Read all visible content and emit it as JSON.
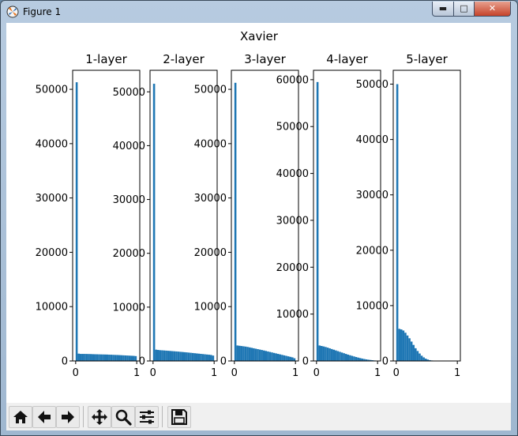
{
  "window": {
    "title": "Figure 1",
    "buttons": {
      "minimize": "▬",
      "maximize": "□",
      "close": "✕"
    }
  },
  "figure": {
    "suptitle": "Xavier"
  },
  "chart_data": [
    {
      "type": "bar",
      "title": "1-layer",
      "xlim": [
        0,
        1
      ],
      "ylim": [
        0,
        53500
      ],
      "xticks": [
        "0",
        "1"
      ],
      "yticks": [
        0,
        10000,
        20000,
        30000,
        40000,
        50000
      ],
      "bins": 30,
      "values": [
        51300,
        1350,
        1300,
        1300,
        1300,
        1290,
        1280,
        1270,
        1250,
        1240,
        1230,
        1220,
        1210,
        1200,
        1190,
        1180,
        1160,
        1150,
        1130,
        1110,
        1100,
        1080,
        1060,
        1040,
        1020,
        1000,
        980,
        960,
        940,
        900
      ],
      "color": "#1f77b4"
    },
    {
      "type": "bar",
      "title": "2-layer",
      "xlim": [
        0,
        1
      ],
      "ylim": [
        0,
        54000
      ],
      "xticks": [
        "0",
        "1"
      ],
      "yticks": [
        0,
        10000,
        20000,
        30000,
        40000,
        50000
      ],
      "bins": 30,
      "values": [
        51500,
        2100,
        2050,
        2000,
        1980,
        1950,
        1920,
        1890,
        1860,
        1830,
        1800,
        1770,
        1740,
        1700,
        1670,
        1630,
        1600,
        1560,
        1520,
        1480,
        1440,
        1400,
        1360,
        1320,
        1280,
        1240,
        1200,
        1160,
        1120,
        1000
      ],
      "color": "#1f77b4"
    },
    {
      "type": "bar",
      "title": "3-layer",
      "xlim": [
        0,
        1
      ],
      "ylim": [
        0,
        53500
      ],
      "xticks": [
        "0",
        "1"
      ],
      "yticks": [
        0,
        10000,
        20000,
        30000,
        40000,
        50000
      ],
      "bins": 30,
      "values": [
        51200,
        2850,
        2800,
        2750,
        2700,
        2650,
        2580,
        2500,
        2420,
        2340,
        2260,
        2180,
        2100,
        2020,
        1930,
        1840,
        1750,
        1660,
        1570,
        1480,
        1390,
        1300,
        1210,
        1120,
        1030,
        940,
        850,
        760,
        670,
        500
      ],
      "color": "#1f77b4"
    },
    {
      "type": "bar",
      "title": "4-layer",
      "xlim": [
        0,
        1
      ],
      "ylim": [
        0,
        62000
      ],
      "xticks": [
        "0",
        "1"
      ],
      "yticks": [
        0,
        10000,
        20000,
        30000,
        40000,
        50000,
        60000
      ],
      "bins": 30,
      "values": [
        59500,
        3300,
        3200,
        3100,
        2980,
        2850,
        2700,
        2550,
        2400,
        2250,
        2100,
        1950,
        1800,
        1650,
        1500,
        1350,
        1220,
        1090,
        960,
        840,
        720,
        610,
        510,
        420,
        340,
        270,
        210,
        160,
        110,
        60
      ],
      "color": "#1f77b4"
    },
    {
      "type": "bar",
      "title": "5-layer",
      "xlim": [
        0,
        1
      ],
      "ylim": [
        0,
        52500
      ],
      "xticks": [
        "0",
        "1"
      ],
      "yticks": [
        0,
        10000,
        20000,
        30000,
        40000,
        50000
      ],
      "bins": 30,
      "values": [
        50000,
        5800,
        5700,
        5500,
        5100,
        4600,
        4100,
        3500,
        2900,
        2300,
        1800,
        1350,
        950,
        650,
        420,
        260,
        150,
        90,
        50,
        30,
        15,
        8,
        4,
        2,
        1,
        0,
        0,
        0,
        0,
        0
      ],
      "color": "#1f77b4"
    }
  ],
  "toolbar": {
    "items": [
      {
        "name": "home-button",
        "icon": "home-icon",
        "tip": "Home"
      },
      {
        "name": "back-button",
        "icon": "arrow-left-icon",
        "tip": "Back"
      },
      {
        "name": "forward-button",
        "icon": "arrow-right-icon",
        "tip": "Forward"
      },
      {
        "name": "pan-button",
        "icon": "move-icon",
        "tip": "Pan"
      },
      {
        "name": "zoom-button",
        "icon": "magnifier-icon",
        "tip": "Zoom"
      },
      {
        "name": "configure-subplots-button",
        "icon": "sliders-icon",
        "tip": "Subplots"
      },
      {
        "name": "save-button",
        "icon": "floppy-icon",
        "tip": "Save"
      }
    ]
  }
}
